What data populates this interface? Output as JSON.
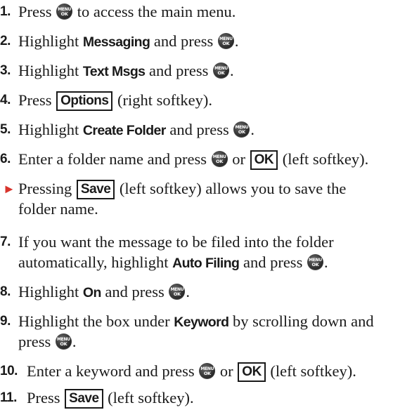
{
  "menu_key": {
    "line1": "MENU",
    "line2": "OK"
  },
  "steps": [
    {
      "number": "1.",
      "text_a": "Press ",
      "text_b": " to access the main menu."
    },
    {
      "number": "2.",
      "text_a": "Highlight ",
      "keyword": "Messaging",
      "text_b": " and press ",
      "end": "."
    },
    {
      "number": "3.",
      "text_a": "Highlight ",
      "keyword": "Text Msgs",
      "text_b": " and press ",
      "end": "."
    },
    {
      "number": "4.",
      "text_a": "Press ",
      "softkey": "Options",
      "text_b": " (right softkey)."
    },
    {
      "number": "5.",
      "text_a": "Highlight ",
      "keyword": "Create Folder",
      "text_b": " and press ",
      "end": "."
    },
    {
      "number": "6.",
      "text_a": "Enter a folder name and press ",
      "text_b": " or ",
      "softkey": "OK",
      "end": " (left softkey)."
    },
    {
      "number": "7.",
      "line1": "If you want the message to be filed into the folder",
      "line2_a": "automatically, highlight ",
      "keyword": "Auto Filing",
      "line2_b": " and press ",
      "end": "."
    },
    {
      "number": "8.",
      "text_a": "Highlight ",
      "keyword": "On",
      "text_b": " and press ",
      "end": "."
    },
    {
      "number": "9.",
      "text_a": "Highlight the box under ",
      "keyword": "Keyword",
      "text_b": " by scrolling down and",
      "line2_a": "press ",
      "end": "."
    },
    {
      "number": "10.",
      "text_a": "Enter a keyword and press ",
      "text_b": " or ",
      "softkey": "OK",
      "end": " (left softkey)."
    },
    {
      "number": "11.",
      "text_a": "Press ",
      "softkey": "Save",
      "end": " (left softkey)."
    }
  ],
  "tip": {
    "bullet": "►",
    "text_a": "Pressing ",
    "softkey": "Save",
    "text_b": " (left softkey) allows you to save the",
    "line2": "folder name."
  },
  "colors": {
    "bullet": "#d8342c",
    "text": "#1a1a1a",
    "key": "#2a2a2a"
  }
}
